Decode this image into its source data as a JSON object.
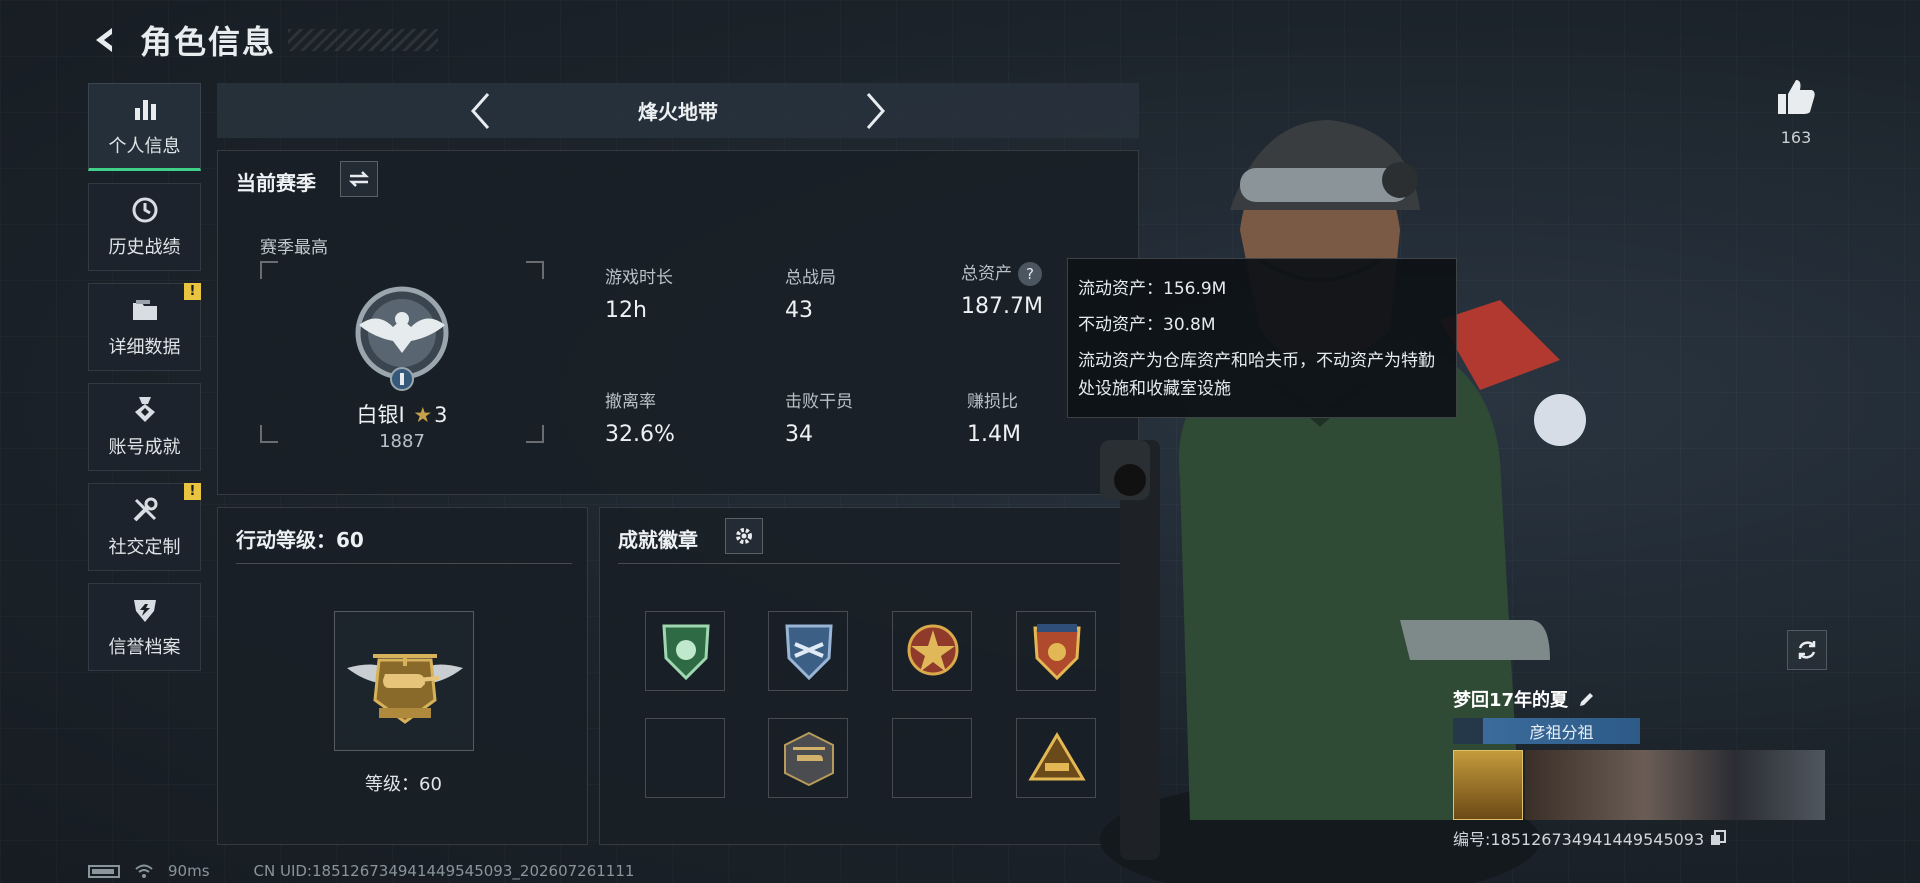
{
  "header": {
    "title": "角色信息"
  },
  "sidebar": {
    "items": [
      {
        "label": "个人信息",
        "icon": "bar-chart-icon",
        "active": true,
        "warn": false
      },
      {
        "label": "历史战绩",
        "icon": "clock-icon",
        "active": false,
        "warn": false
      },
      {
        "label": "详细数据",
        "icon": "folder-icon",
        "active": false,
        "warn": true
      },
      {
        "label": "账号成就",
        "icon": "medal-icon",
        "active": false,
        "warn": false
      },
      {
        "label": "社交定制",
        "icon": "tools-icon",
        "active": false,
        "warn": true
      },
      {
        "label": "信誉档案",
        "icon": "shield-icon",
        "active": false,
        "warn": false
      }
    ],
    "warn_mark": "!"
  },
  "mode": {
    "title": "烽火地带"
  },
  "season": {
    "title": "当前赛季",
    "best_label": "赛季最高",
    "rank_name": "白银I",
    "rank_stars": "3",
    "rank_score": "1887",
    "stats": [
      {
        "label": "游戏时长",
        "value": "12h"
      },
      {
        "label": "总战局",
        "value": "43"
      },
      {
        "label": "总资产",
        "value": "187.7M"
      },
      {
        "label": "撤离率",
        "value": "32.6%"
      },
      {
        "label": "击败干员",
        "value": "34"
      },
      {
        "label": "赚损比",
        "value": "1.4M"
      }
    ]
  },
  "tooltip": {
    "liquid": "流动资产：156.9M",
    "fixed": "不动资产：30.8M",
    "desc": "流动资产为仓库资产和哈夫币，不动资产为特勤处设施和收藏室设施"
  },
  "action_level": {
    "title": "行动等级：60",
    "level_text": "等级：60"
  },
  "achievements": {
    "title": "成就徽章"
  },
  "like": {
    "count": "163"
  },
  "profile": {
    "name": "梦回17年的夏",
    "tag": "彦祖分祖",
    "id": "编号:1851267349414495450­93"
  },
  "footer": {
    "ping": "90ms",
    "uid": "CN UID:1851267349414495450­93_202607261111"
  },
  "colors": {
    "accent_green": "#3fd08a",
    "warn_yellow": "#e8c440",
    "gold": "#c9a04a"
  }
}
